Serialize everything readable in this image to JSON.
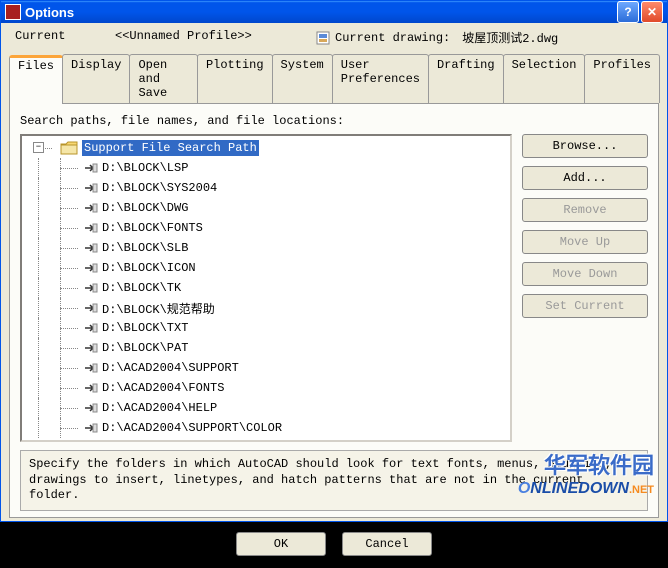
{
  "window": {
    "title": "Options"
  },
  "header": {
    "current_label": "Current",
    "profile_name": "<<Unnamed Profile>>",
    "drawing_label": "Current drawing:",
    "drawing_name": "坡屋顶测试2.dwg"
  },
  "tabs": [
    "Files",
    "Display",
    "Open and Save",
    "Plotting",
    "System",
    "User Preferences",
    "Drafting",
    "Selection",
    "Profiles"
  ],
  "active_tab": 0,
  "files_tab": {
    "section_label": "Search paths, file names, and file locations:",
    "root_label": "Support File Search Path",
    "paths": [
      "D:\\BLOCK\\LSP",
      "D:\\BLOCK\\SYS2004",
      "D:\\BLOCK\\DWG",
      "D:\\BLOCK\\FONTS",
      "D:\\BLOCK\\SLB",
      "D:\\BLOCK\\ICON",
      "D:\\BLOCK\\TK",
      "D:\\BLOCK\\规范帮助",
      "D:\\BLOCK\\TXT",
      "D:\\BLOCK\\PAT",
      "D:\\ACAD2004\\SUPPORT",
      "D:\\ACAD2004\\FONTS",
      "D:\\ACAD2004\\HELP",
      "D:\\ACAD2004\\SUPPORT\\COLOR"
    ],
    "description": "Specify the folders in which AutoCAD should look for text fonts, menus, plug-ins, drawings to insert, linetypes, and hatch patterns that are not in the current folder."
  },
  "buttons": {
    "browse": "Browse...",
    "add": "Add...",
    "remove": "Remove",
    "move_up": "Move Up",
    "move_down": "Move Down",
    "set_current": "Set Current",
    "ok": "OK",
    "cancel": "Cancel"
  },
  "watermark": {
    "cn": "华军软件园",
    "en_pre": "O",
    "en_main": "NLINEDOWN",
    "en_suf": ".NET"
  }
}
